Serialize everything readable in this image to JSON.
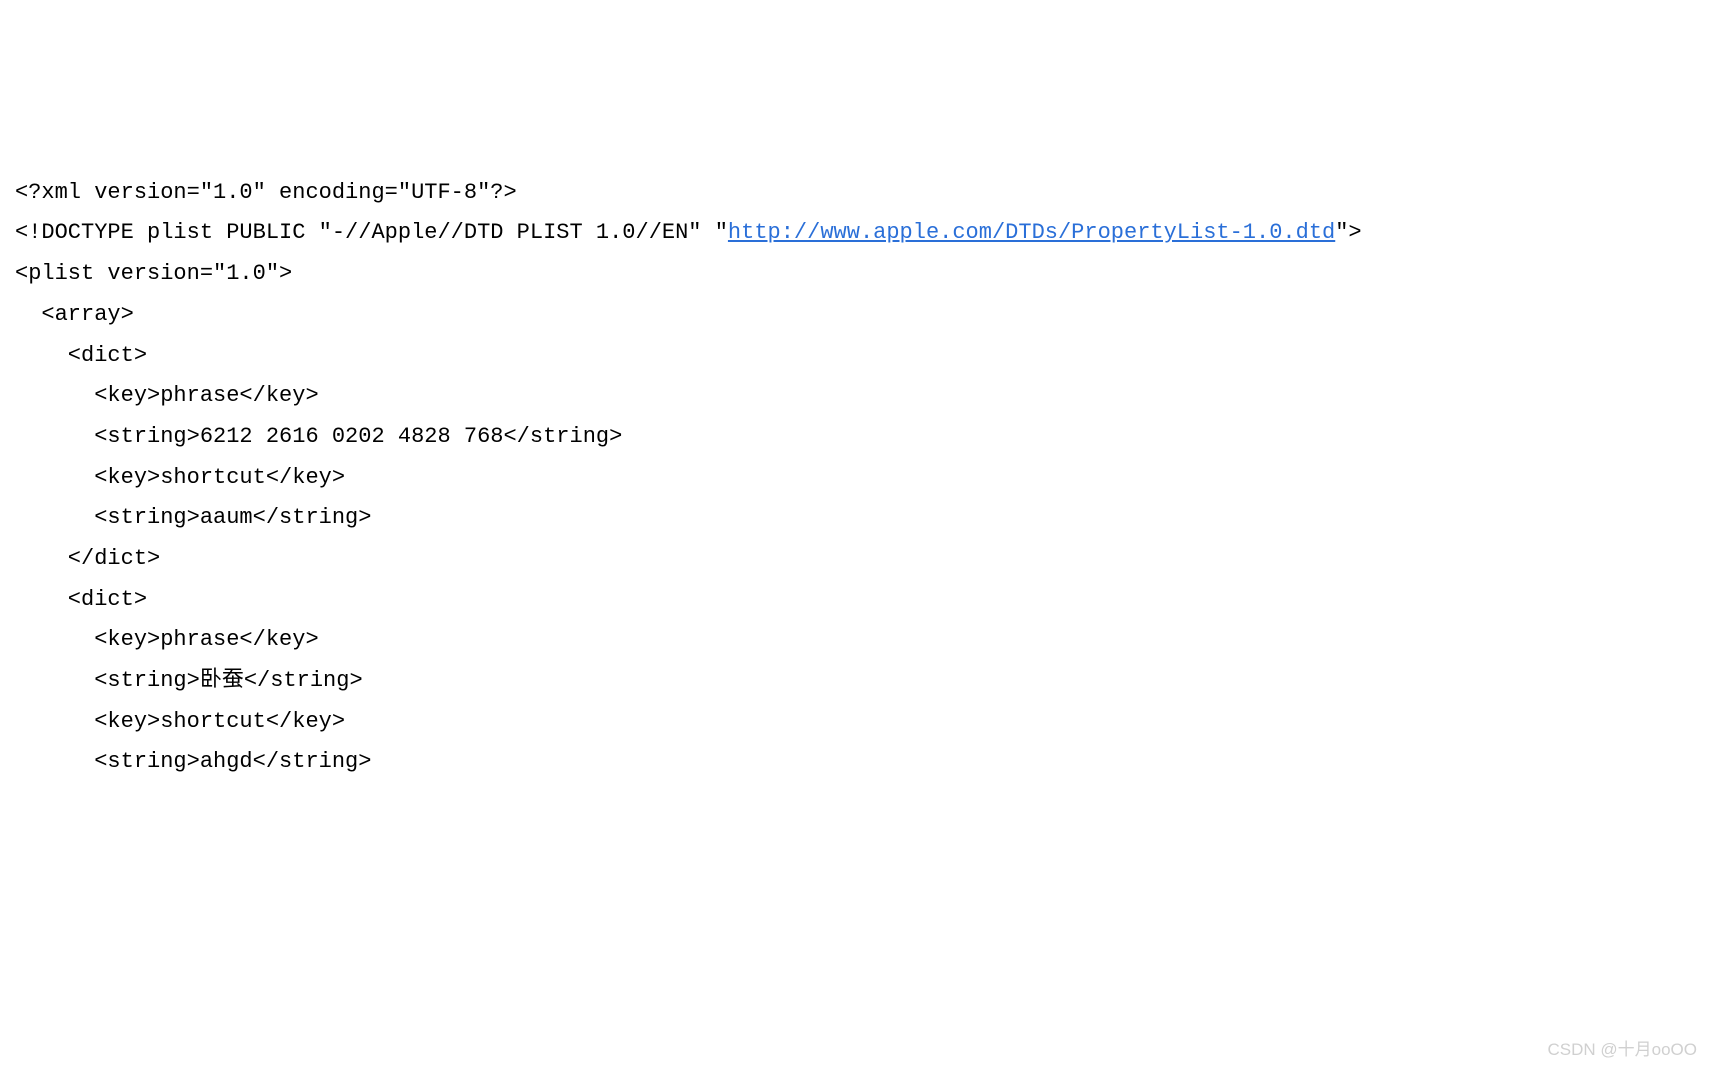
{
  "xml": {
    "declaration_open": "<?xml version=\"1.0\" encoding=\"UTF-8\"?>",
    "doctype_prefix": "<!DOCTYPE plist PUBLIC \"-//Apple//DTD PLIST 1.0//EN\" \"",
    "doctype_url": "http://www.apple.com/DTDs/PropertyList-1.0.dtd",
    "doctype_suffix": "\">",
    "plist_open": "<plist version=\"1.0\">",
    "array_open": "  <array>",
    "dict_open": "    <dict>",
    "dict_close": "    </dict>",
    "key_phrase": "      <key>phrase</key>",
    "key_shortcut": "      <key>shortcut</key>",
    "entries": [
      {
        "phrase_line": "      <string>6212 2616 0202 4828 768</string>",
        "shortcut_line": "      <string>aaum</string>"
      },
      {
        "phrase_line": "      <string>卧蚕</string>",
        "shortcut_line": "      <string>ahgd</string>"
      }
    ]
  },
  "watermark": "CSDN @十月ooOO"
}
